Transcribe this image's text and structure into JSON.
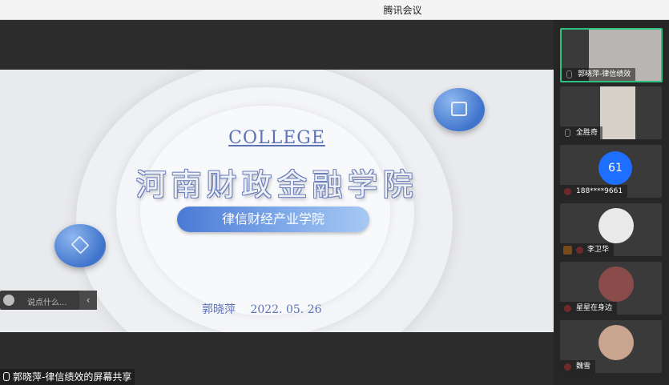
{
  "window": {
    "title": "腾讯会议"
  },
  "slide": {
    "college": "COLLEGE",
    "school_cn": "河南财政金融学院",
    "department": "律信财经产业学院",
    "presenter": "郭晓萍",
    "date": "2022. 05. 26"
  },
  "chat": {
    "placeholder": "说点什么..."
  },
  "share_banner": "郭晓萍-律信绩效的屏幕共享",
  "participants": [
    {
      "name": "郭晓萍-律信绩效",
      "type": "video",
      "active": true
    },
    {
      "name": "全胜奇",
      "type": "video"
    },
    {
      "name": "188****9661",
      "type": "number",
      "avatar_text": "61"
    },
    {
      "name": "李卫华",
      "type": "avatar"
    },
    {
      "name": "星星在身边",
      "type": "avatar"
    },
    {
      "name": "魏雪",
      "type": "avatar"
    }
  ],
  "colors": {
    "accent": "#5d72b6",
    "active_border": "#2ec27e",
    "avatar_blue": "#1e6fff"
  }
}
